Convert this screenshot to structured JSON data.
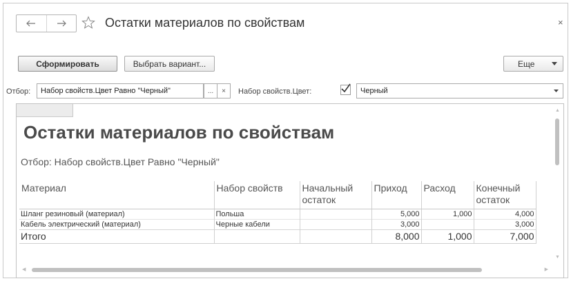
{
  "header": {
    "title": "Остатки материалов по свойствам",
    "back_icon": "arrow-left-icon",
    "forward_icon": "arrow-right-icon",
    "favorite_icon": "star-icon",
    "close_label": "×"
  },
  "toolbar": {
    "generate_label": "Сформировать",
    "variant_label": "Выбрать вариант...",
    "more_label": "Еще"
  },
  "filter": {
    "label": "Отбор:",
    "value": "Набор свойств.Цвет Равно \"Черный\"",
    "select_btn": "...",
    "clear_btn": "×",
    "color_label": "Набор свойств.Цвет:",
    "color_checked": true,
    "color_value": "Черный"
  },
  "report": {
    "title": "Остатки материалов по свойствам",
    "filter_line": "Отбор: Набор свойств.Цвет Равно \"Черный\"",
    "columns": [
      "Материал",
      "Набор свойств",
      "Начальный остаток",
      "Приход",
      "Расход",
      "Конечный остаток"
    ],
    "rows": [
      [
        "Шланг резиновый (материал)",
        "Польша",
        "",
        "5,000",
        "1,000",
        "4,000"
      ],
      [
        "Кабель электрический (материал)",
        "Черные кабели",
        "",
        "3,000",
        "",
        "3,000"
      ]
    ],
    "total": [
      "Итого",
      "",
      "",
      "8,000",
      "1,000",
      "7,000"
    ]
  },
  "colors": {
    "border": "#c8c8c8",
    "button_border": "#a9a9a9",
    "title_text": "#4a4a4a",
    "scroll_thumb": "#c0c0c0"
  }
}
